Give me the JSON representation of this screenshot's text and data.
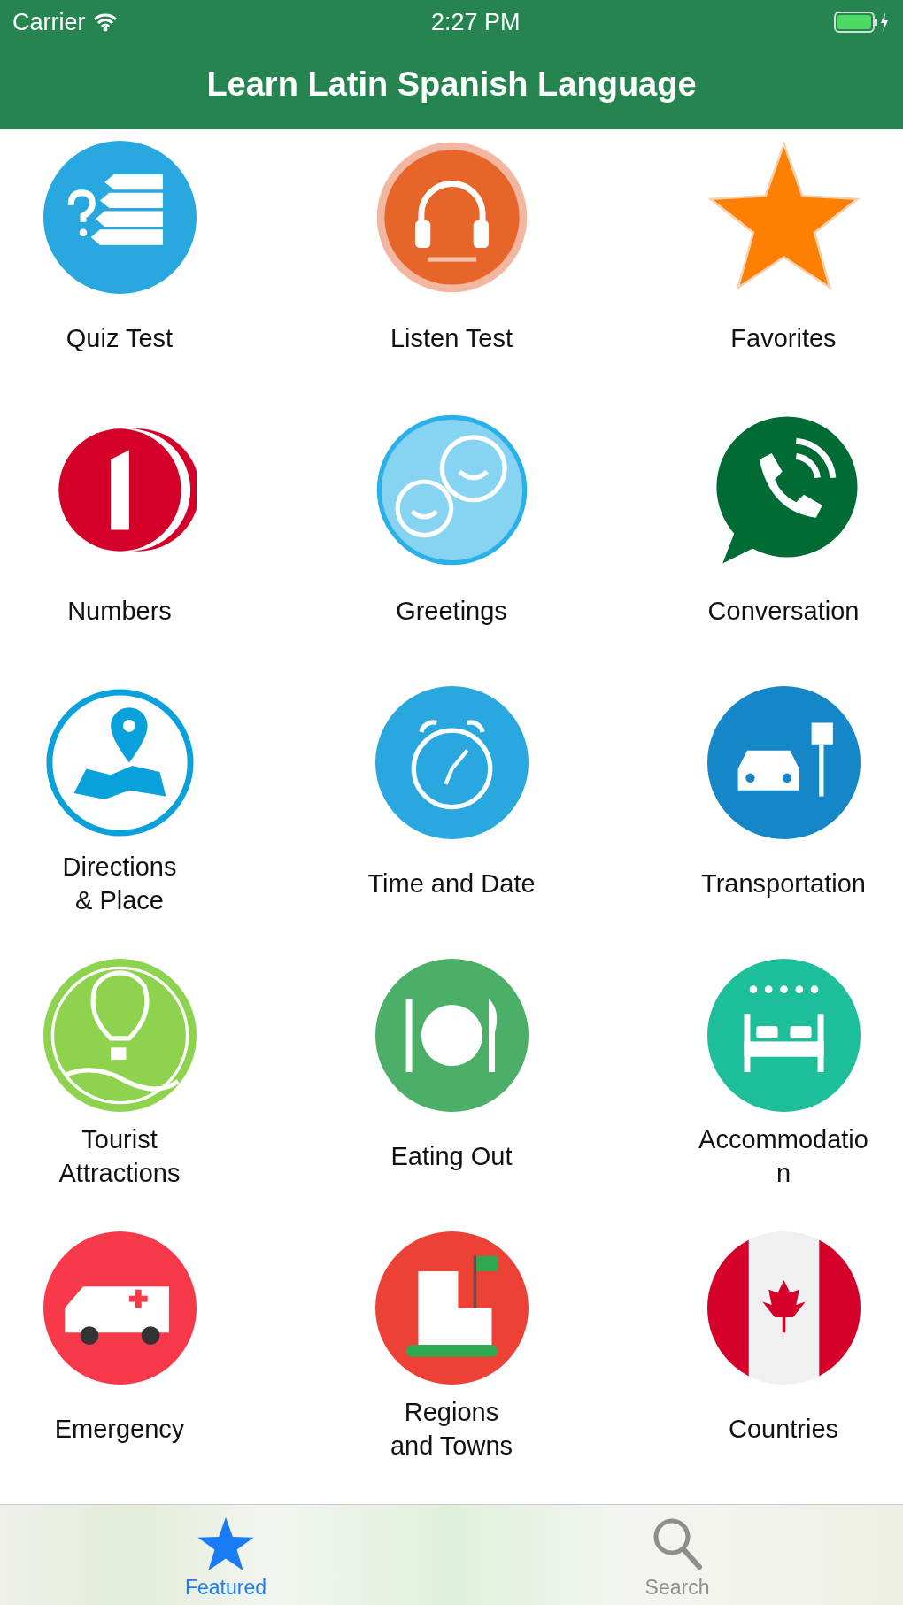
{
  "status_bar": {
    "carrier": "Carrier",
    "time": "2:27 PM"
  },
  "nav_bar": {
    "title": "Learn Latin Spanish Language"
  },
  "categories": [
    {
      "label": [
        "Quiz Test"
      ]
    },
    {
      "label": [
        "Listen Test"
      ]
    },
    {
      "label": [
        "Favorites"
      ]
    },
    {
      "label": [
        "Numbers"
      ]
    },
    {
      "label": [
        "Greetings"
      ]
    },
    {
      "label": [
        "Conversation"
      ]
    },
    {
      "label": [
        "Directions",
        "& Place"
      ]
    },
    {
      "label": [
        "Time and Date"
      ]
    },
    {
      "label": [
        "Transportation"
      ]
    },
    {
      "label": [
        "Tourist",
        "Attractions"
      ]
    },
    {
      "label": [
        "Eating Out"
      ]
    },
    {
      "label": [
        "Accommodatio",
        "n"
      ]
    },
    {
      "label": [
        "Emergency"
      ]
    },
    {
      "label": [
        "Regions",
        "and Towns"
      ]
    },
    {
      "label": [
        "Countries"
      ]
    }
  ],
  "tab_bar": [
    {
      "label": "Featured",
      "selected": true
    },
    {
      "label": "Search",
      "selected": false
    }
  ]
}
